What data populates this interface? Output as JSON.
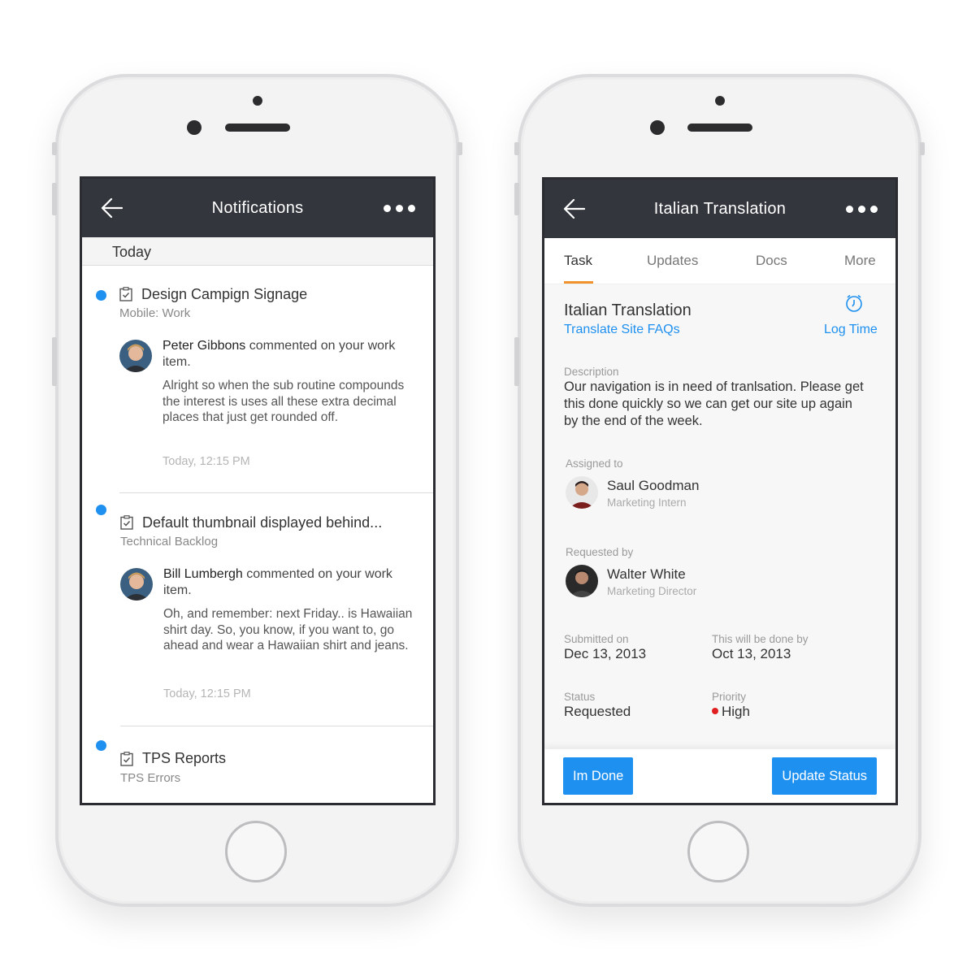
{
  "left_screen": {
    "title": "Notifications",
    "section": "Today",
    "notifications": [
      {
        "title": "Design Campign Signage",
        "subtitle": "Mobile: Work",
        "author": "Peter Gibbons",
        "action": "commented on your work item.",
        "body": "Alright so when the sub routine compounds the interest is uses all these extra decimal places that just get rounded off.",
        "time": "Today, 12:15 PM"
      },
      {
        "title": "Default thumbnail displayed behind...",
        "subtitle": "Technical Backlog",
        "author": "Bill Lumbergh",
        "action": "commented on your work item.",
        "body": "Oh, and remember: next Friday.. is Hawaiian shirt day. So, you know, if you want to, go ahead and wear a Hawaiian shirt and jeans.",
        "time": "Today, 12:15 PM"
      },
      {
        "title": "TPS Reports",
        "subtitle": "TPS Errors"
      }
    ]
  },
  "right_screen": {
    "title": "Italian Translation",
    "tabs": [
      "Task",
      "Updates",
      "Docs",
      "More"
    ],
    "task_title": "Italian Translation",
    "task_link": "Translate Site FAQs",
    "log_time": "Log Time",
    "description_label": "Description",
    "description": "Our navigation is in need of tranlsation. Please get this done quickly so we can get our site up again by the end of the week.",
    "assigned_label": "Assigned to",
    "assignee": {
      "name": "Saul Goodman",
      "role": "Marketing Intern"
    },
    "requested_label": "Requested by",
    "requester": {
      "name": "Walter White",
      "role": "Marketing Director"
    },
    "submitted_label": "Submitted on",
    "submitted": "Dec 13, 2013",
    "due_label": "This will be done by",
    "due": "Oct 13, 2013",
    "status_label": "Status",
    "status": "Requested",
    "priority_label": "Priority",
    "priority": "High",
    "done_button": "Im Done",
    "update_button": "Update Status"
  },
  "colors": {
    "accent": "#1e90ef",
    "navbar": "#33363d",
    "tab_indicator": "#f0922d",
    "priority_high": "#e02020"
  }
}
